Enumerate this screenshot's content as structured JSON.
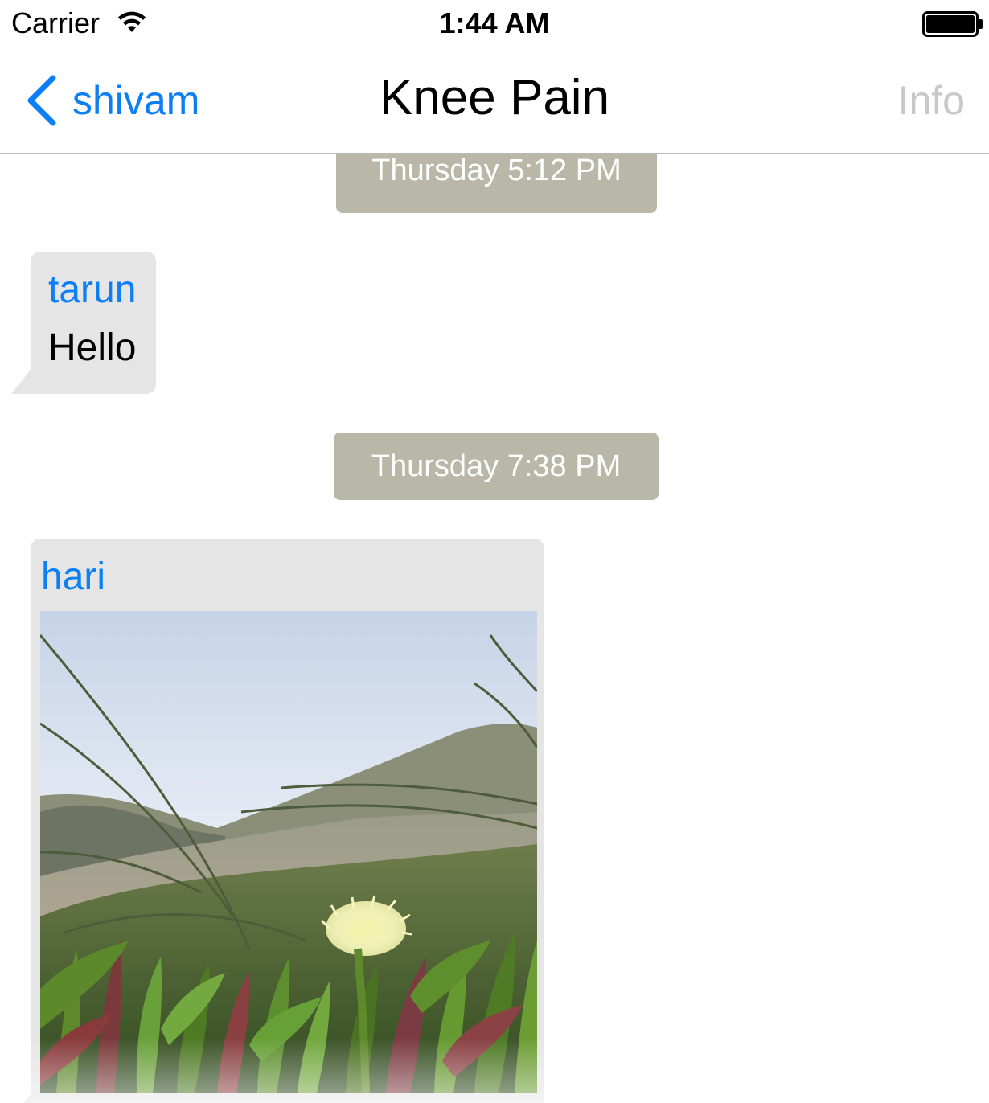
{
  "status_bar": {
    "carrier": "Carrier",
    "time": "1:44 AM",
    "wifi_icon": "wifi-icon",
    "battery_icon": "battery-icon"
  },
  "nav": {
    "back_label": "shivam",
    "back_icon": "chevron-left-icon",
    "title": "Knee Pain",
    "info_label": "Info",
    "accent_color": "#0d7ff5",
    "info_color": "#c8c8cc"
  },
  "messages": [
    {
      "type": "timestamp",
      "text": "Thursday 5:12 PM"
    },
    {
      "type": "text",
      "sender": "tarun",
      "text": "Hello"
    },
    {
      "type": "timestamp",
      "text": "Thursday 7:38 PM"
    },
    {
      "type": "image",
      "sender": "hari"
    }
  ],
  "colors": {
    "timestamp_bg": "#b8b7a8",
    "bubble_bg": "#e5e5e5",
    "sender_color": "#0d7ff5"
  }
}
